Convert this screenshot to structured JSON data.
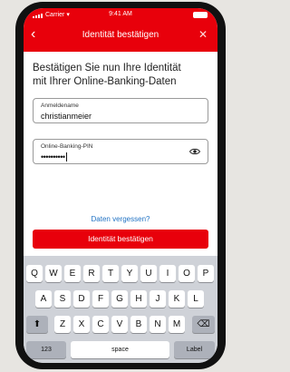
{
  "status_bar": {
    "carrier": "Carrier",
    "time": "9:41 AM"
  },
  "nav": {
    "title": "Identität bestätigen",
    "back_icon": "chevron-left-icon",
    "close_icon": "close-icon"
  },
  "content": {
    "heading_line1": "Bestätigen Sie nun Ihre Identität",
    "heading_line2": "mit Ihrer Online-Banking-Daten",
    "username": {
      "label": "Anmeldename",
      "value": "christianmeier"
    },
    "pin": {
      "label": "Online-Banking-PIN",
      "value": "••••••••••",
      "toggle_icon": "eye-icon"
    },
    "forgot_link": "Daten vergessen?",
    "confirm_button": "Identität bestätigen"
  },
  "keyboard": {
    "row1": [
      "Q",
      "W",
      "E",
      "R",
      "T",
      "Y",
      "U",
      "I",
      "O",
      "P"
    ],
    "row2": [
      "A",
      "S",
      "D",
      "F",
      "G",
      "H",
      "J",
      "K",
      "L"
    ],
    "row3": [
      "Z",
      "X",
      "C",
      "V",
      "B",
      "N",
      "M"
    ],
    "bottom": {
      "numbers": "123",
      "space": "space",
      "label": "Label"
    },
    "shift_icon": "shift-icon",
    "delete_icon": "delete-icon"
  },
  "colors": {
    "accent": "#e8000b",
    "link": "#2273c4",
    "keyboard_bg": "#cfd2d8"
  }
}
